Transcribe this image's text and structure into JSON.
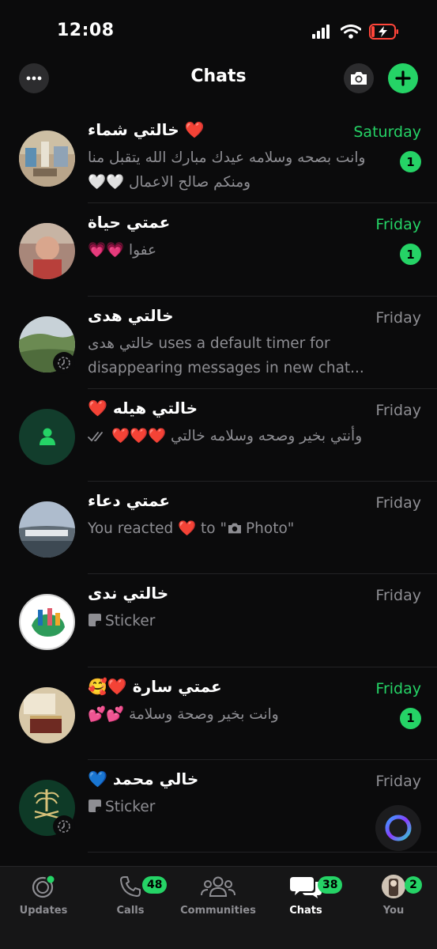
{
  "status_bar": {
    "time": "12:08"
  },
  "nav": {
    "title": "Chats"
  },
  "chats": [
    {
      "name": "❤️ خالتي شماء",
      "time": "Saturday",
      "preview": "وانت بصحه وسلامه عيدك مبارك  الله يتقبل منا ومنكم صالح الاعمال 🤍🤍",
      "unread": "1"
    },
    {
      "name": "عمتي حياة",
      "time": "Friday",
      "preview": "عفوا 💗💗",
      "unread": "1"
    },
    {
      "name": "خالتي هدى",
      "time": "Friday",
      "preview": "خالتي هدى uses a default timer for disappearing messages in new chat..."
    },
    {
      "name": "خالتي هيله ❤️",
      "time": "Friday",
      "preview": "وأنتي بخير وصحه وسلامه خالتي ❤️❤️❤️"
    },
    {
      "name": "عمتي دعاء",
      "time": "Friday",
      "preview_parts": [
        "You reacted ",
        "❤️",
        " to \"",
        "Photo",
        "\""
      ]
    },
    {
      "name": "خالتي ندى",
      "time": "Friday",
      "preview": "Sticker"
    },
    {
      "name": "عمتي سارة ❤️🥰",
      "time": "Friday",
      "preview": "وانت بخير وصحة وسلامة 💕💕",
      "unread": "1"
    },
    {
      "name": "خالي محمد 💙",
      "time": "Friday",
      "preview": "Sticker"
    }
  ],
  "tabs": [
    {
      "label": "Updates",
      "icon": "updates-icon"
    },
    {
      "label": "Calls",
      "badge": "48",
      "icon": "phone-icon"
    },
    {
      "label": "Communities",
      "icon": "communities-icon"
    },
    {
      "label": "Chats",
      "badge": "38",
      "icon": "chats-icon",
      "active": true
    },
    {
      "label": "You",
      "badge": "2",
      "icon": "profile-avatar"
    }
  ],
  "colors": {
    "accent": "#25d366",
    "background": "#0b0b0c",
    "secondary_text": "#8e8e93",
    "battery_low": "#ff453a"
  }
}
